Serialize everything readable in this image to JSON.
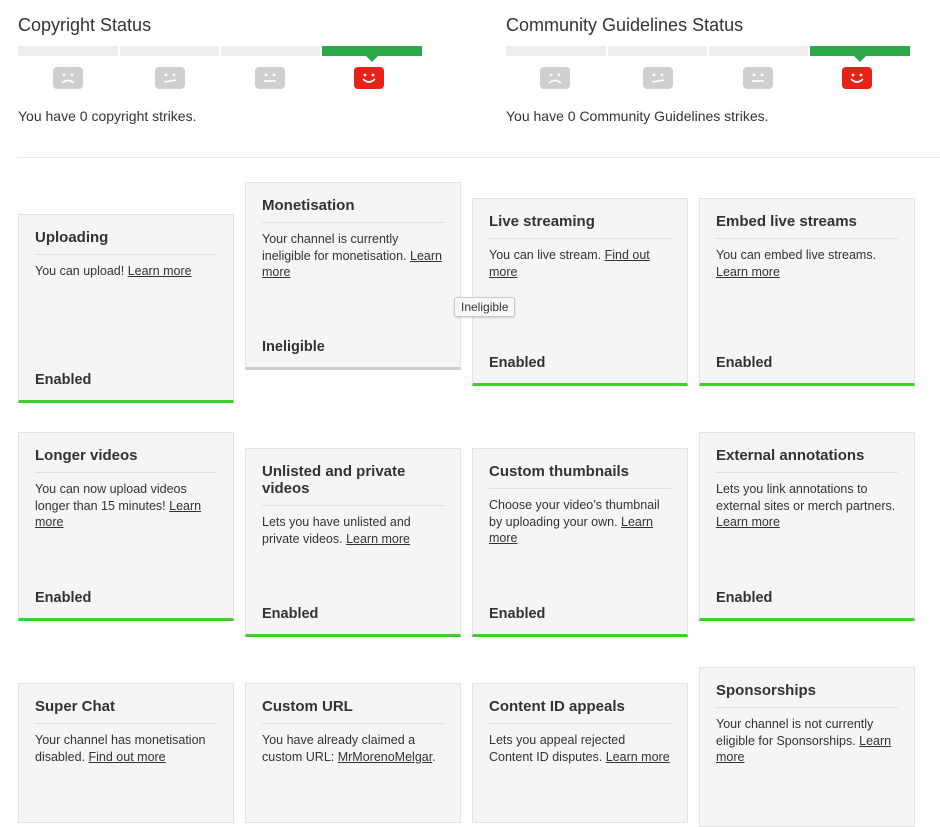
{
  "copyright": {
    "title": "Copyright Status",
    "message": "You have 0 copyright strikes.",
    "active_level": 4
  },
  "community": {
    "title": "Community Guidelines Status",
    "message": "You have 0 Community Guidelines strikes.",
    "active_level": 4
  },
  "colors": {
    "active_bar": "#2ba84a",
    "enabled_bar": "#3ecf2e",
    "happy_face": "#e62117",
    "sad_face": "#cfcfcf"
  },
  "tooltip": "Ineligible",
  "cards": {
    "uploading": {
      "title": "Uploading",
      "desc": "You can upload! ",
      "link": "Learn more",
      "state": "Enabled"
    },
    "monetisation": {
      "title": "Monetisation",
      "desc": "Your channel is currently ineligible for monetisation. ",
      "link": "Learn more",
      "state": "Ineligible"
    },
    "live": {
      "title": "Live streaming",
      "desc": "You can live stream. ",
      "link": "Find out more",
      "state": "Enabled"
    },
    "embed": {
      "title": "Embed live streams",
      "desc": "You can embed live streams. ",
      "link": "Learn more",
      "state": "Enabled"
    },
    "longer": {
      "title": "Longer videos",
      "desc": "You can now upload videos longer than 15 minutes! ",
      "link": "Learn more",
      "state": "Enabled"
    },
    "unlisted": {
      "title": "Unlisted and private videos",
      "desc": "Lets you have unlisted and private videos. ",
      "link": "Learn more",
      "state": "Enabled"
    },
    "thumbs": {
      "title": "Custom thumbnails",
      "desc": "Choose your video’s thumbnail by uploading your own. ",
      "link": "Learn more",
      "state": "Enabled"
    },
    "annotations": {
      "title": "External annotations",
      "desc": "Lets you link annotations to external sites or merch partners. ",
      "link": "Learn more",
      "state": "Enabled"
    },
    "superchat": {
      "title": "Super Chat",
      "desc": "Your channel has monetisation disabled. ",
      "link": "Find out more"
    },
    "customurl": {
      "title": "Custom URL",
      "desc": "You have already claimed a custom URL: ",
      "link": "MrMorenoMelgar",
      "suffix": "."
    },
    "contentid": {
      "title": "Content ID appeals",
      "desc": "Lets you appeal rejected Content ID disputes. ",
      "link": "Learn more"
    },
    "sponsorships": {
      "title": "Sponsorships",
      "desc": "Your channel is not currently eligible for Sponsorships. ",
      "link": "Learn more"
    }
  }
}
